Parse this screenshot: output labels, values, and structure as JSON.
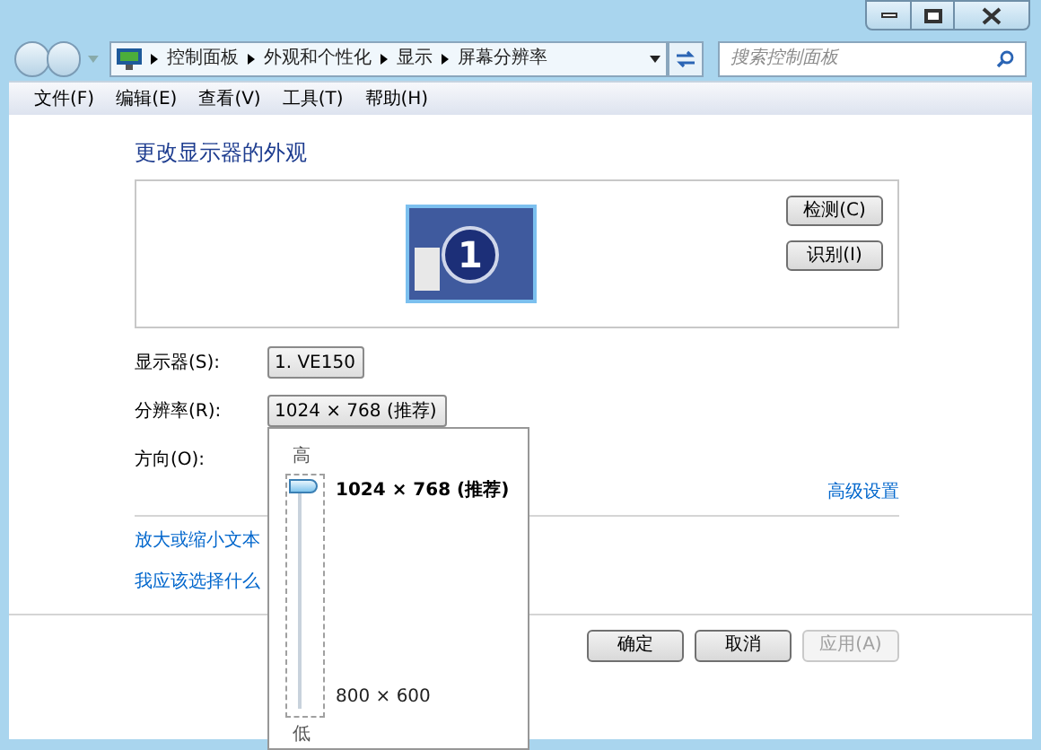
{
  "address_bar": {
    "breadcrumbs": [
      "控制面板",
      "外观和个性化",
      "显示",
      "屏幕分辨率"
    ]
  },
  "search": {
    "placeholder": "搜索控制面板"
  },
  "menu": [
    "文件(F)",
    "编辑(E)",
    "查看(V)",
    "工具(T)",
    "帮助(H)"
  ],
  "heading": "更改显示器的外观",
  "preview": {
    "monitor_number": "1",
    "buttons": [
      "检测(C)",
      "识别(I)"
    ]
  },
  "fields": [
    {
      "label": "显示器(S):",
      "value": "1. VE150"
    },
    {
      "label": "分辨率(R):",
      "value": "1024 × 768 (推荐)"
    },
    {
      "label": "方向(O):"
    }
  ],
  "resolution_popup": {
    "high_label": "高",
    "low_label": "低",
    "level": 1,
    "options": [
      {
        "label": "1024 × 768 (推荐)",
        "selected": true
      },
      {
        "label": "800 × 600",
        "selected": false
      }
    ]
  },
  "advanced_link": "高级设置",
  "links": [
    "放大或缩小文本",
    "我应该选择什么"
  ],
  "dialog_buttons": [
    {
      "label": "确定",
      "disabled": false
    },
    {
      "label": "取消",
      "disabled": false
    },
    {
      "label": "应用(A)",
      "disabled": true
    }
  ]
}
